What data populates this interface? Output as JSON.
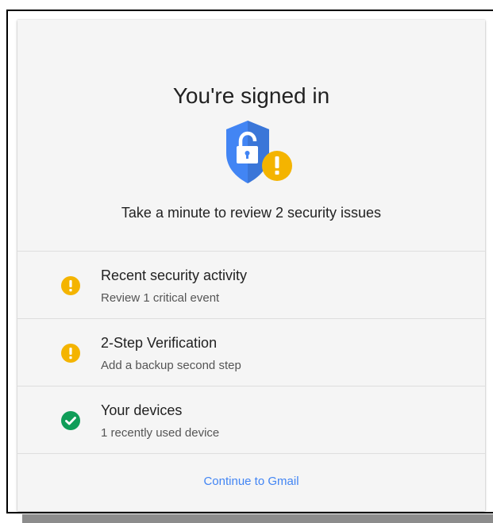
{
  "card": {
    "title": "You're signed in",
    "subtitle": "Take a minute to review 2 security issues",
    "continue_label": "Continue to Gmail"
  },
  "items": [
    {
      "title": "Recent security activity",
      "subtitle": "Review 1 critical event",
      "status": "warning",
      "icon": "alert-icon"
    },
    {
      "title": "2-Step Verification",
      "subtitle": "Add a backup second step",
      "status": "warning",
      "icon": "alert-icon"
    },
    {
      "title": "Your devices",
      "subtitle": "1 recently used device",
      "status": "ok",
      "icon": "check-icon"
    }
  ],
  "colors": {
    "shield": "#4285f4",
    "warning": "#f4b400",
    "success": "#0f9d58",
    "link": "#4285f4"
  }
}
